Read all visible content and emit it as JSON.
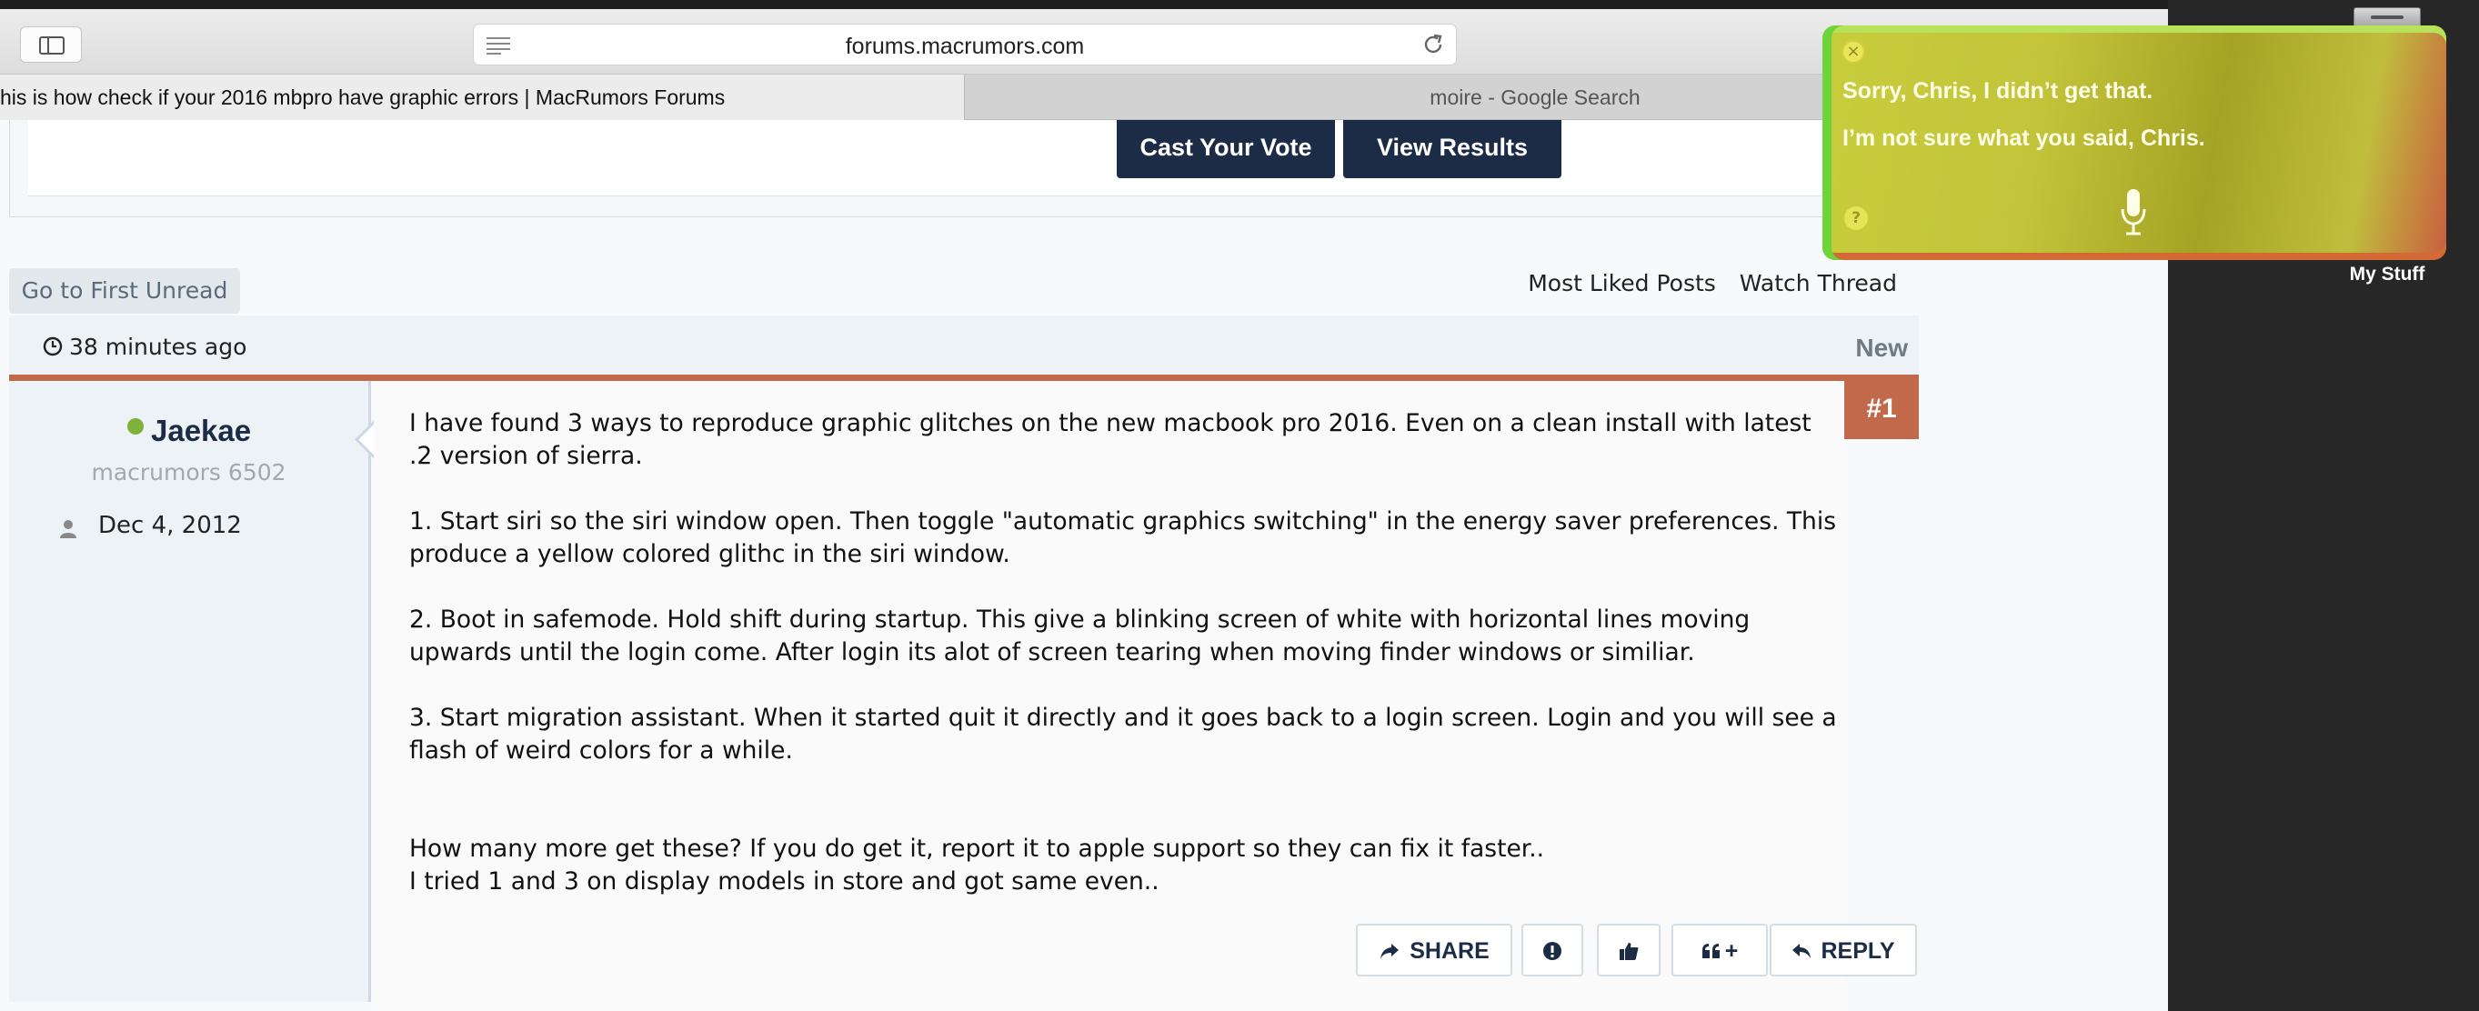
{
  "browser": {
    "url": "forums.macrumors.com",
    "tabs": [
      {
        "label": "his is how check if your 2016 mbpro have graphic errors | MacRumors Forums",
        "active": true
      },
      {
        "label": "moire - Google Search",
        "active": false
      }
    ]
  },
  "poll": {
    "cast_vote_label": "Cast Your Vote",
    "view_results_label": "View Results"
  },
  "thread": {
    "first_unread_label": "Go to First Unread",
    "most_liked_label": "Most Liked Posts",
    "watch_label": "Watch Thread"
  },
  "post": {
    "time": "38 minutes ago",
    "new_badge": "New",
    "number": "#1",
    "author": {
      "name": "Jaekae",
      "title": "macrumors 6502",
      "join_date": "Dec 4, 2012"
    },
    "paragraphs": [
      "I have found 3 ways to reproduce graphic glitches on the new macbook pro 2016. Even on a clean install with latest\n.2 version of sierra.",
      "1. Start siri so the siri window open. Then toggle \"automatic graphics switching\" in the energy saver preferences. This\nproduce a yellow colored glithc in the siri window.",
      "2. Boot in safemode. Hold shift during startup. This give a blinking screen of white with horizontal lines moving\nupwards until the login come. After login its alot of screen tearing when moving finder windows or similiar.",
      "3. Start migration assistant. When it started quit it directly and it goes back to a login screen. Login and you will see a\nflash of weird colors for a while.",
      "How many more get these? If you do get it, report it to apple support so they can fix it faster..\nI tried 1 and 3 on display models in store and got same even.."
    ],
    "actions": {
      "share_label": "SHARE",
      "multiquote_label": "+",
      "reply_label": "REPLY"
    }
  },
  "siri": {
    "line1": "Sorry, Chris, I didn’t get that.",
    "line2": "I’m not sure what you said, Chris.",
    "help_glyph": "?"
  },
  "desktop": {
    "icon_label": "My Stuff"
  },
  "colors": {
    "brand_dark": "#1c2c47",
    "post_accent": "#c2694b",
    "online": "#7fb23b",
    "siri_yellow": "#c3c43a"
  },
  "icons": [
    "sidebar-icon",
    "reader-icon",
    "reload-icon",
    "clock-icon",
    "person-icon",
    "share-icon",
    "report-icon",
    "like-icon",
    "quote-icon",
    "reply-icon",
    "microphone-icon",
    "close-icon",
    "help-icon",
    "drive-icon"
  ]
}
